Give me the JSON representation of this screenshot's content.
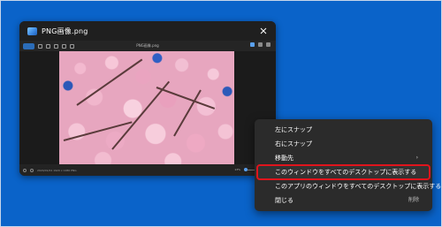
{
  "window": {
    "title": "PNG画像.png",
    "file_label": "PNG画像.png"
  },
  "statusbar": {
    "info": "2024/01/01  1920 x 1280  PNG",
    "zoom": "13%"
  },
  "menu": {
    "items": [
      {
        "label": "左にスナップ"
      },
      {
        "label": "右にスナップ"
      },
      {
        "label": "移動先",
        "arrow": "›"
      },
      {
        "label": "このウィンドウをすべてのデスクトップに表示する",
        "highlighted": true
      },
      {
        "label": "このアプリのウィンドウをすべてのデスクトップに表示する"
      },
      {
        "label": "閉じる",
        "shortcut": "削除"
      }
    ]
  },
  "colors": {
    "desktop": "#0a63c9",
    "highlight_border": "#e0141c",
    "accent": "#2b6cb8"
  }
}
